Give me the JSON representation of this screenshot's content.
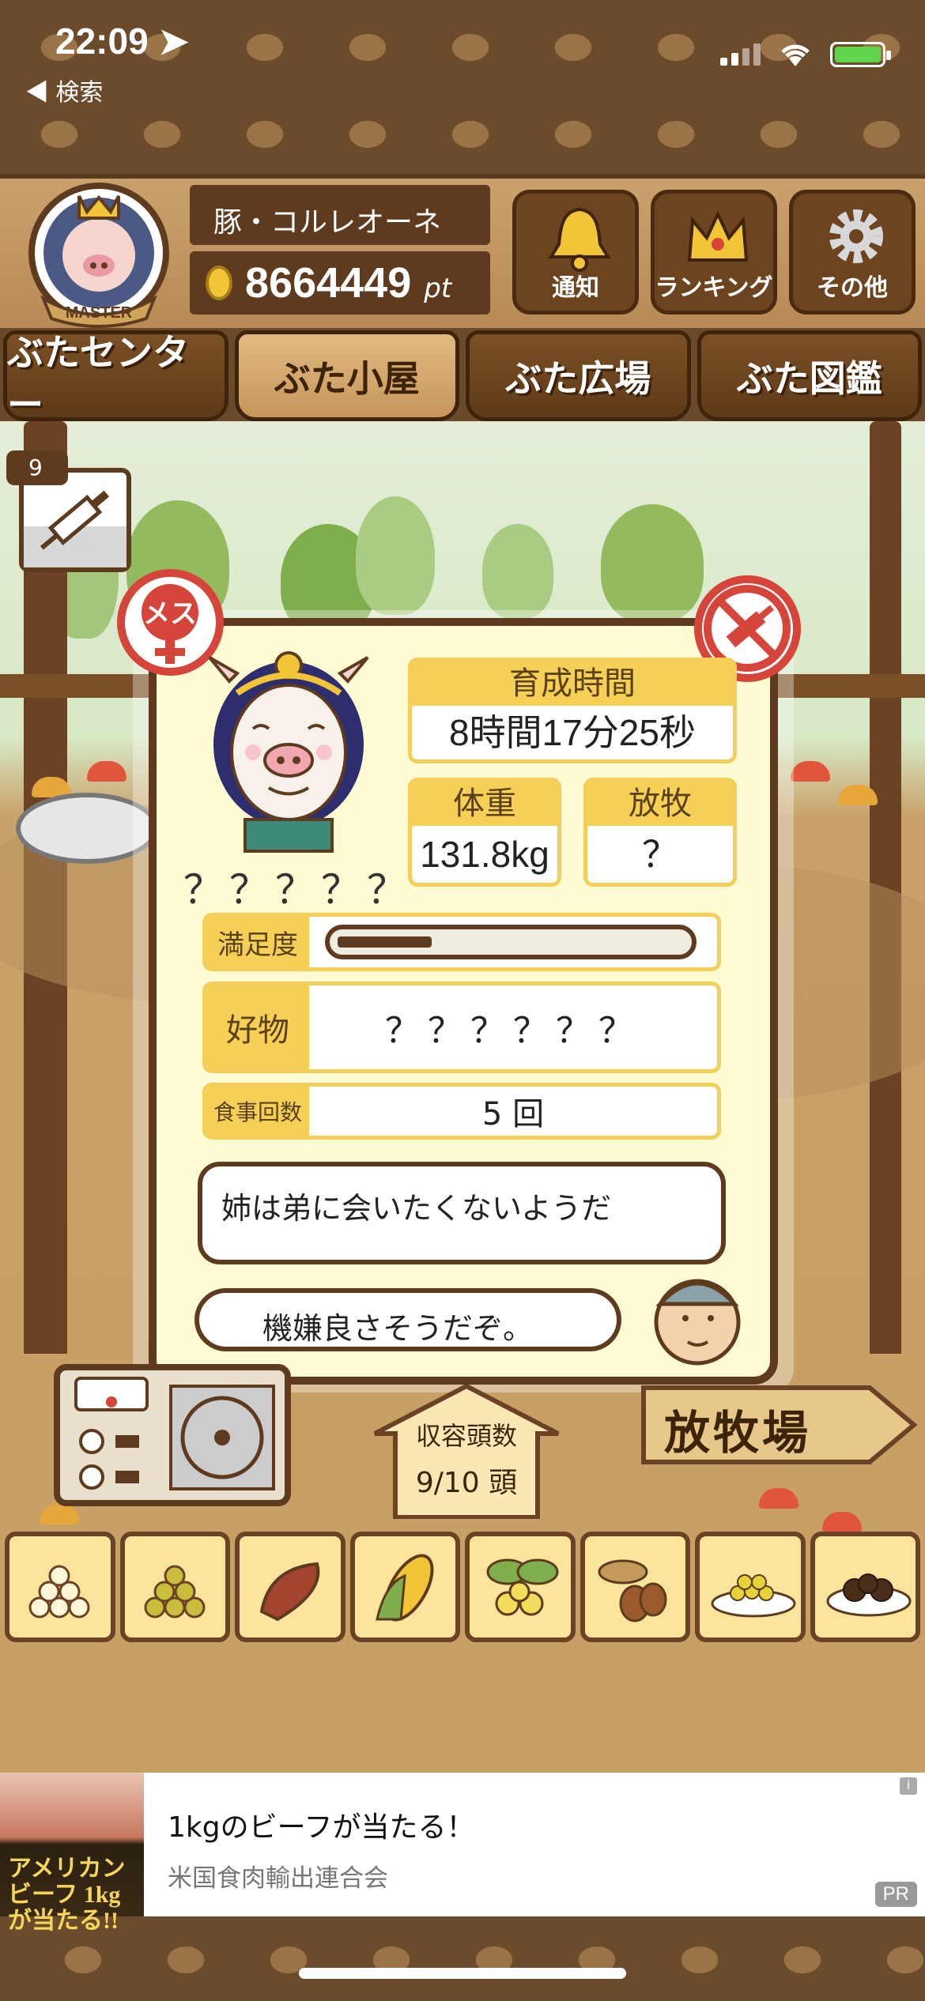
{
  "status_bar": {
    "time": "22:09 ➤",
    "back_label": "◀ 検索"
  },
  "header": {
    "player_name": "豚・コルレオーネ",
    "points": "8664449",
    "points_unit": "pt",
    "avatar_badge": "MASTER",
    "buttons": [
      {
        "label": "通知",
        "icon": "bell-icon"
      },
      {
        "label": "ランキング",
        "icon": "crown-icon"
      },
      {
        "label": "その他",
        "icon": "gear-icon"
      }
    ]
  },
  "nav_tabs": [
    {
      "label": "ぶたセンター",
      "active": false
    },
    {
      "label": "ぶた小屋",
      "active": true
    },
    {
      "label": "ぶた広場",
      "active": false
    },
    {
      "label": "ぶた図鑑",
      "active": false
    }
  ],
  "item": {
    "syringe_count": "9"
  },
  "modal": {
    "gender_badge": "メス",
    "pig_name": "？？？？？",
    "growth_time_label": "育成時間",
    "growth_time_value": "8時間17分25秒",
    "weight_label": "体重",
    "weight_value": "131.8kg",
    "grazing_label": "放牧",
    "grazing_value": "？",
    "satisfaction_label": "満足度",
    "satisfaction_level": 0.27,
    "favorite_label": "好物",
    "favorite_value": "？？？？？？",
    "meals_label": "食事回数",
    "meals_value": "5 回",
    "speech_text": "姉は弟に会いたくないようだ",
    "mood_text": "機嫌良さそうだぞ。"
  },
  "scene": {
    "capacity_label": "収容頭数",
    "capacity_value": "9/10 頭",
    "pasture_sign": "放牧場"
  },
  "foods": [
    "food-grain-white",
    "food-grain-yellow",
    "food-sweet-potato",
    "food-corn",
    "food-nuts-leaf",
    "food-acorn",
    "food-beans-plate",
    "food-truffle-plate"
  ],
  "ad": {
    "title": "1kgのビーフが当たる！",
    "advertiser": "米国食肉輸出連合会",
    "image_text": "アメリカンビーフ 1kgが当たる!!",
    "pr_label": "PR",
    "info_label": "i"
  }
}
